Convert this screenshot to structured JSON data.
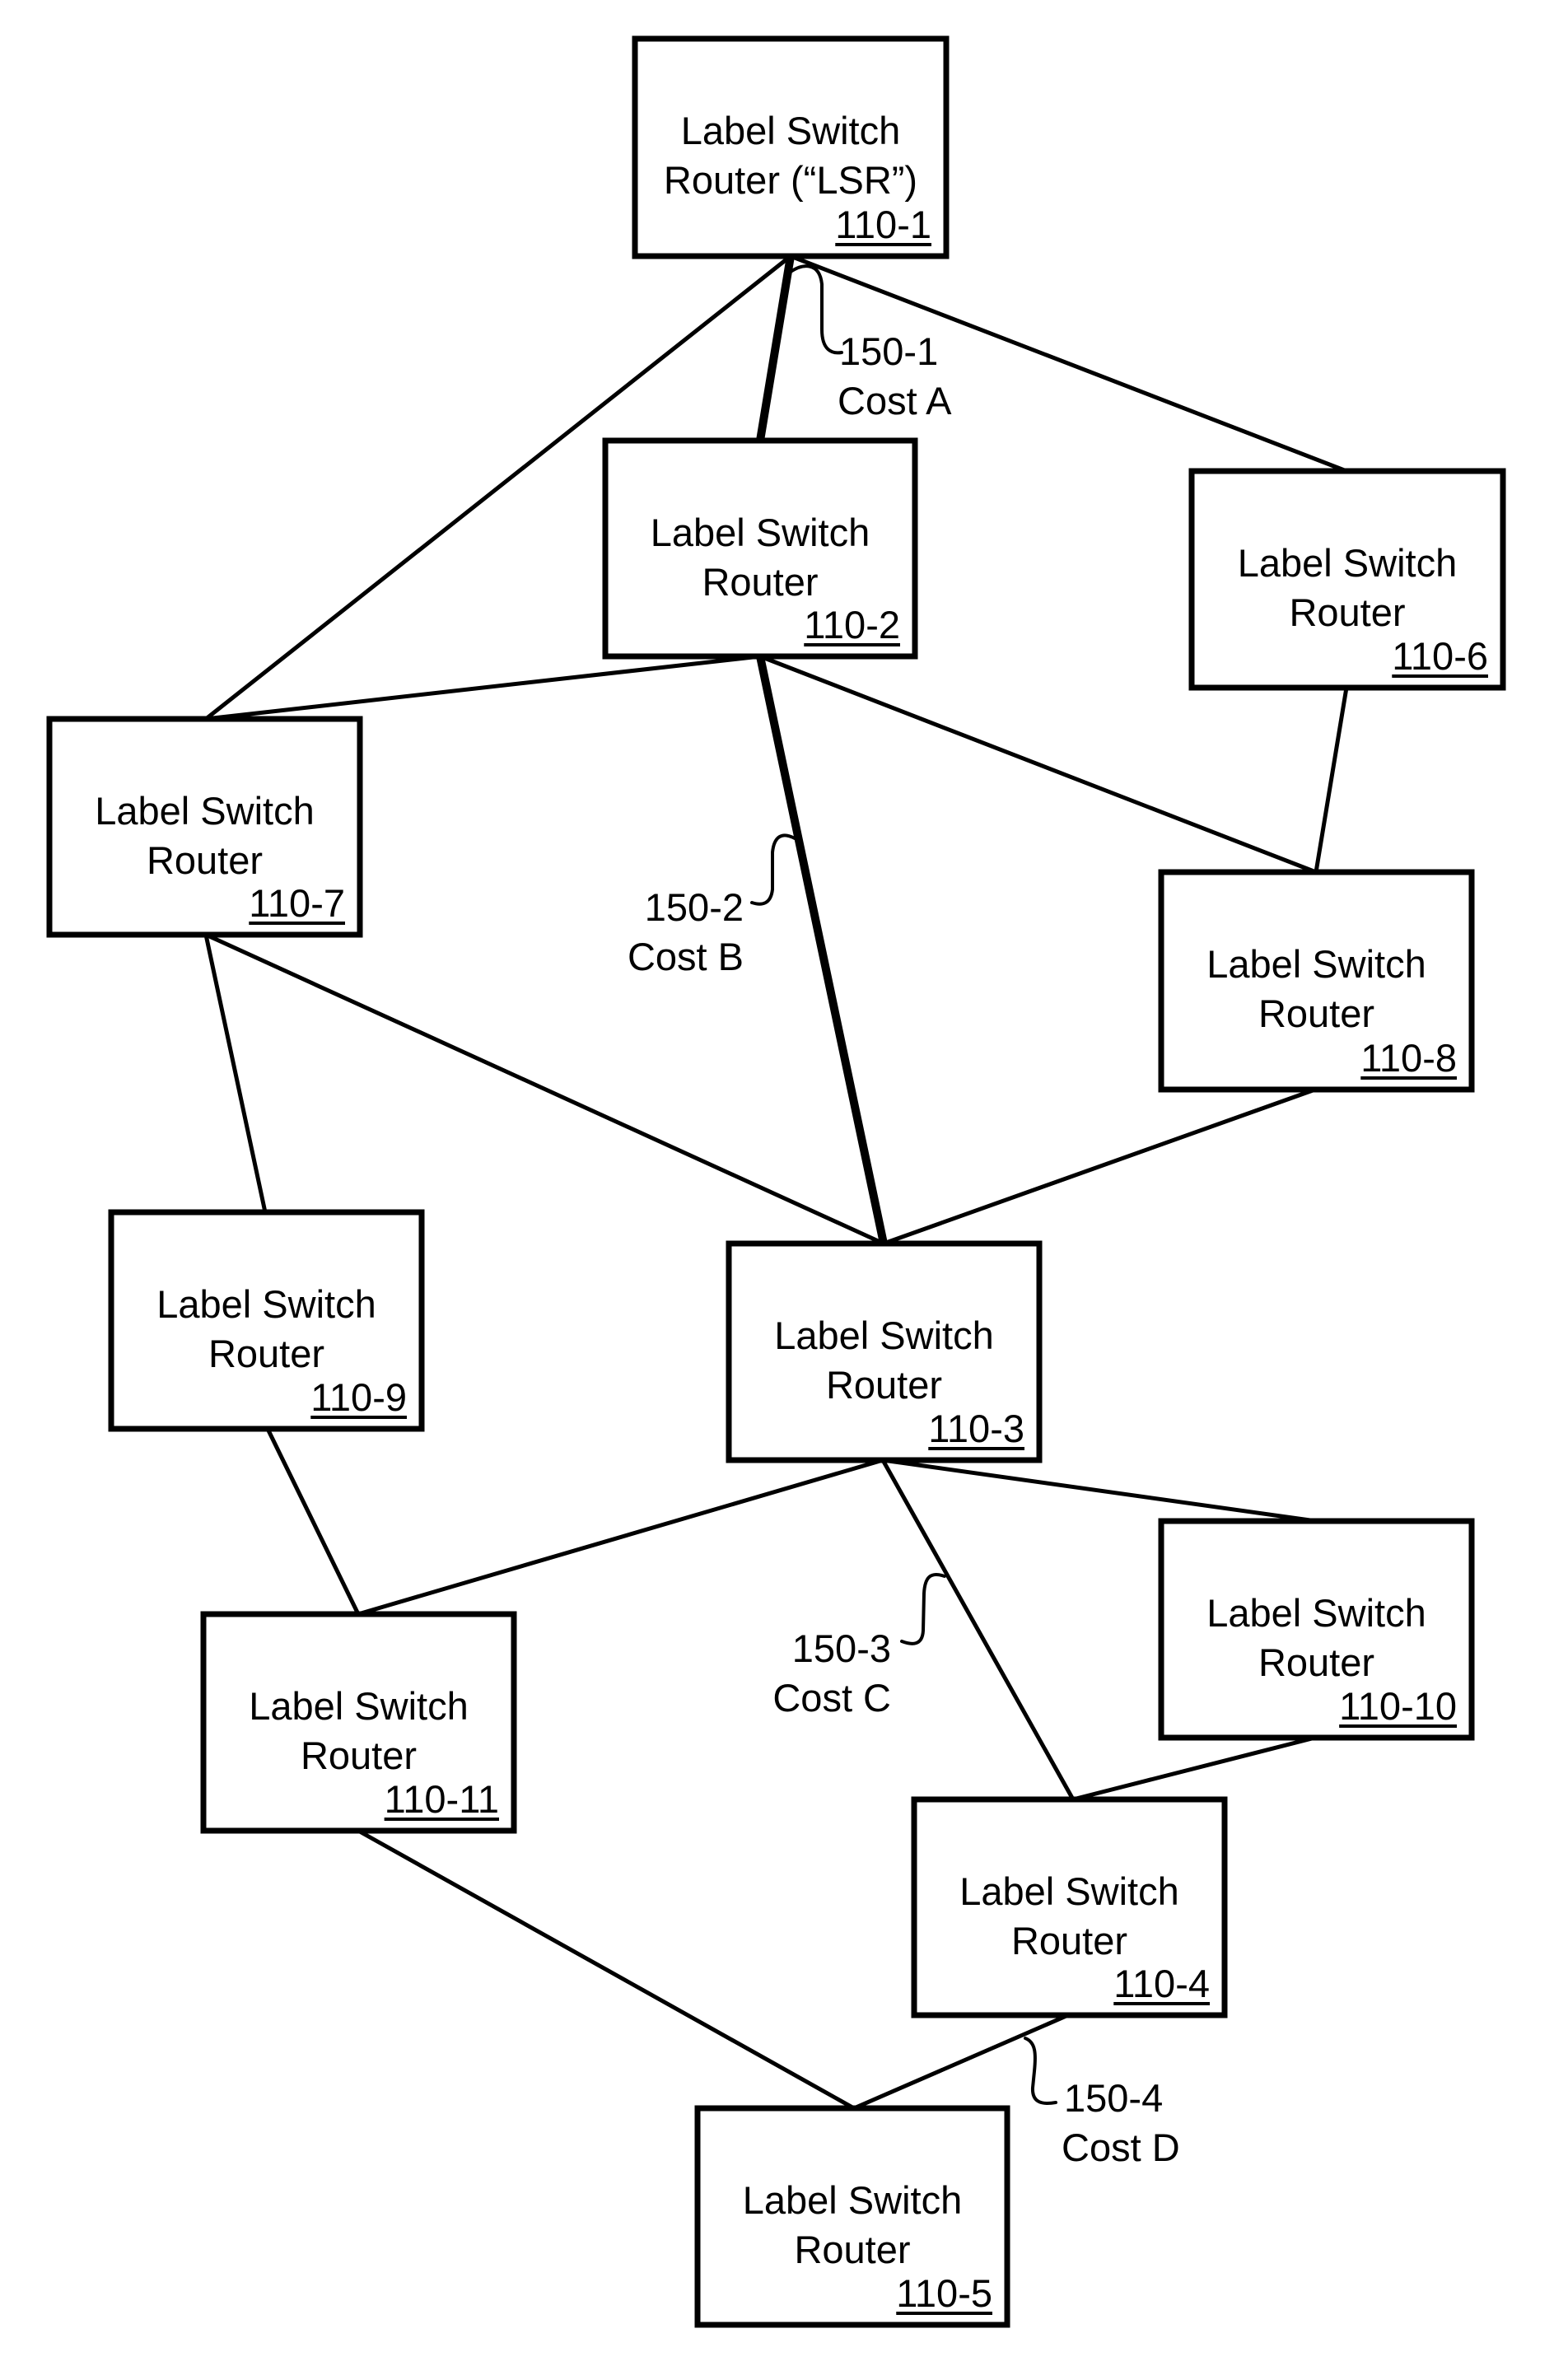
{
  "diagram": {
    "type": "network-topology",
    "nodes": [
      {
        "id": "110-1",
        "line1": "Label Switch",
        "line2": "Router (“LSR”)"
      },
      {
        "id": "110-2",
        "line1": "Label Switch",
        "line2": "Router"
      },
      {
        "id": "110-3",
        "line1": "Label Switch",
        "line2": "Router"
      },
      {
        "id": "110-4",
        "line1": "Label Switch",
        "line2": "Router"
      },
      {
        "id": "110-5",
        "line1": "Label Switch",
        "line2": "Router"
      },
      {
        "id": "110-6",
        "line1": "Label Switch",
        "line2": "Router"
      },
      {
        "id": "110-7",
        "line1": "Label Switch",
        "line2": "Router"
      },
      {
        "id": "110-8",
        "line1": "Label Switch",
        "line2": "Router"
      },
      {
        "id": "110-9",
        "line1": "Label Switch",
        "line2": "Router"
      },
      {
        "id": "110-10",
        "line1": "Label Switch",
        "line2": "Router"
      },
      {
        "id": "110-11",
        "line1": "Label Switch",
        "line2": "Router"
      }
    ],
    "links": [
      {
        "from": "110-1",
        "to": "110-2",
        "primary_path": true,
        "label_id": "150-1",
        "label_cost": "Cost A"
      },
      {
        "from": "110-1",
        "to": "110-7",
        "primary_path": false
      },
      {
        "from": "110-1",
        "to": "110-6",
        "primary_path": false
      },
      {
        "from": "110-2",
        "to": "110-7",
        "primary_path": false
      },
      {
        "from": "110-2",
        "to": "110-3",
        "primary_path": true,
        "label_id": "150-2",
        "label_cost": "Cost B"
      },
      {
        "from": "110-2",
        "to": "110-8",
        "primary_path": false
      },
      {
        "from": "110-6",
        "to": "110-8",
        "primary_path": false
      },
      {
        "from": "110-7",
        "to": "110-9",
        "primary_path": false
      },
      {
        "from": "110-7",
        "to": "110-3",
        "primary_path": false
      },
      {
        "from": "110-8",
        "to": "110-3",
        "primary_path": false
      },
      {
        "from": "110-9",
        "to": "110-11",
        "primary_path": false
      },
      {
        "from": "110-3",
        "to": "110-11",
        "primary_path": false
      },
      {
        "from": "110-3",
        "to": "110-4",
        "primary_path": false,
        "label_id": "150-3",
        "label_cost": "Cost C"
      },
      {
        "from": "110-3",
        "to": "110-10",
        "primary_path": false
      },
      {
        "from": "110-10",
        "to": "110-4",
        "primary_path": false
      },
      {
        "from": "110-11",
        "to": "110-5",
        "primary_path": false
      },
      {
        "from": "110-4",
        "to": "110-5",
        "primary_path": false,
        "label_id": "150-4",
        "label_cost": "Cost D"
      }
    ]
  }
}
